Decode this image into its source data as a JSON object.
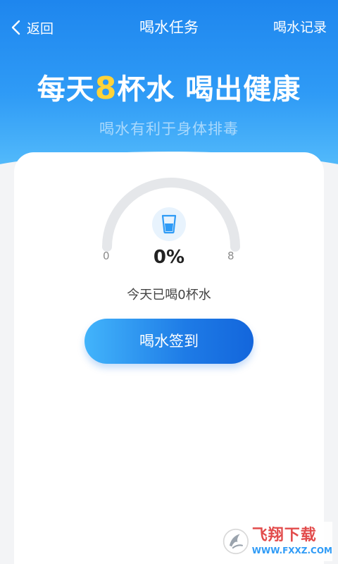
{
  "nav": {
    "back_label": "返回",
    "title": "喝水任务",
    "right_label": "喝水记录"
  },
  "hero": {
    "headline_pre": "每天",
    "headline_num": "8",
    "headline_post": "杯水 喝出健康",
    "subline": "喝水有利于身体排毒"
  },
  "progress": {
    "min_label": "0",
    "max_label": "8",
    "percent_text": "0%",
    "fraction": 0.0,
    "drunk_text": "今天已喝0杯水"
  },
  "actions": {
    "checkin_label": "喝水签到"
  },
  "watermark": {
    "title": "飞翔下载",
    "url": "WWW.FXXZ.COM"
  },
  "colors": {
    "brand_blue": "#1e86ee",
    "accent_yellow": "#ffd339",
    "button_start": "#42b4fb",
    "button_end": "#1366dc"
  },
  "icons": [
    "back-chevron-icon",
    "water-cup-icon",
    "site-logo-icon"
  ]
}
